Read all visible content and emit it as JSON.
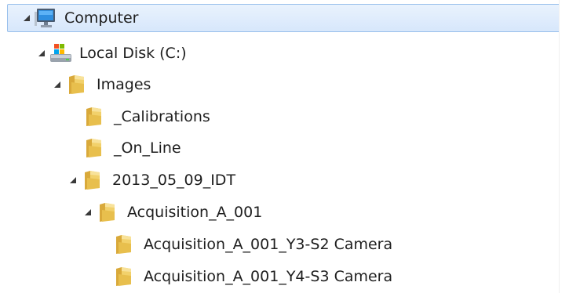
{
  "tree": {
    "items": [
      {
        "label": "Computer",
        "icon": "computer-icon",
        "expanded": true,
        "selected": true
      },
      {
        "label": "Local Disk (C:)",
        "icon": "drive-icon",
        "expanded": true
      },
      {
        "label": "Images",
        "icon": "folder-icon",
        "expanded": true
      },
      {
        "label": "_Calibrations",
        "icon": "folder-icon"
      },
      {
        "label": "_On_Line",
        "icon": "folder-icon"
      },
      {
        "label": "2013_05_09_IDT",
        "icon": "folder-icon",
        "expanded": true
      },
      {
        "label": "Acquisition_A_001",
        "icon": "folder-icon",
        "expanded": true
      },
      {
        "label": "Acquisition_A_001_Y3-S2 Camera",
        "icon": "folder-icon"
      },
      {
        "label": "Acquisition_A_001_Y4-S3 Camera",
        "icon": "folder-icon"
      }
    ]
  },
  "colors": {
    "selection_fill_top": "#e9f2fd",
    "selection_fill_bottom": "#d7e7fb",
    "selection_border": "#99c0ec",
    "folder": "#e8c45f",
    "arrow": "#3a3a3a"
  }
}
